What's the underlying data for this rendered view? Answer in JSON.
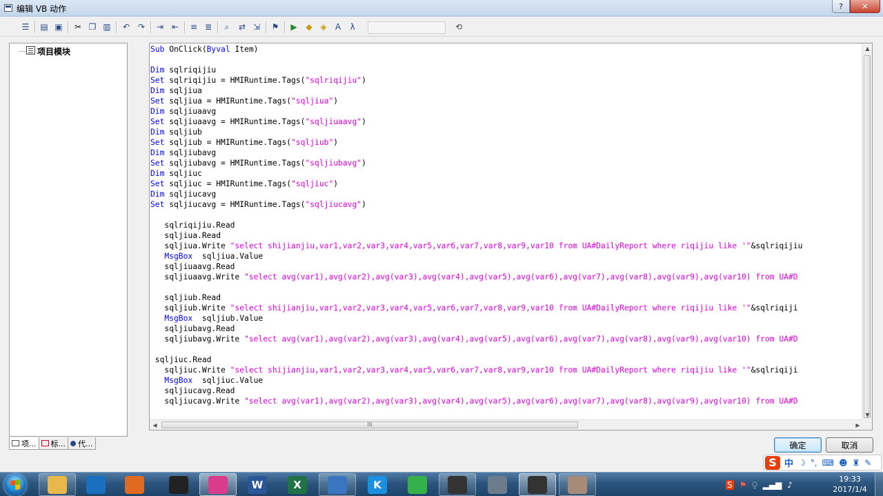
{
  "window": {
    "title": "编辑 VB 动作",
    "controls": {
      "help_label": "?",
      "close_label": "✕"
    }
  },
  "toolbar": {
    "icons": [
      "indent-icon",
      "outdent-icon",
      "print-icon",
      "print-preview-icon",
      "cut-icon",
      "copy-icon",
      "paste-icon",
      "undo-icon",
      "redo-icon",
      "increase-indent-icon",
      "decrease-indent-icon",
      "comment-icon",
      "uncomment-icon",
      "find-icon",
      "replace-icon",
      "goto-icon",
      "bookmark-icon",
      "compile-icon",
      "object-icon",
      "package-icon",
      "font-icon",
      "function-icon",
      "help-icon"
    ]
  },
  "tree": {
    "items": [
      {
        "label": "项目模块"
      }
    ]
  },
  "bottom_tabs": [
    {
      "label": "项..."
    },
    {
      "label": "标..."
    },
    {
      "label": "代..."
    }
  ],
  "code": {
    "lines": [
      [
        [
          "kw",
          "Sub"
        ],
        [
          "t",
          " OnClick("
        ],
        [
          "kw",
          "Byval"
        ],
        [
          "t",
          " Item)"
        ]
      ],
      [],
      [
        [
          "kw",
          "Dim"
        ],
        [
          "t",
          " sqlriqijiu"
        ]
      ],
      [
        [
          "kw",
          "Set"
        ],
        [
          "t",
          " sqlriqijiu = HMIRuntime.Tags("
        ],
        [
          "str",
          "\"sqlriqijiu\""
        ],
        [
          "t",
          ")"
        ]
      ],
      [
        [
          "kw",
          "Dim"
        ],
        [
          "t",
          " sqljiua"
        ]
      ],
      [
        [
          "kw",
          "Set"
        ],
        [
          "t",
          " sqljiua = HMIRuntime.Tags("
        ],
        [
          "str",
          "\"sqljiua\""
        ],
        [
          "t",
          ")"
        ]
      ],
      [
        [
          "kw",
          "Dim"
        ],
        [
          "t",
          " sqljiuaavg"
        ]
      ],
      [
        [
          "kw",
          "Set"
        ],
        [
          "t",
          " sqljiuaavg = HMIRuntime.Tags("
        ],
        [
          "str",
          "\"sqljiuaavg\""
        ],
        [
          "t",
          ")"
        ]
      ],
      [
        [
          "kw",
          "Dim"
        ],
        [
          "t",
          " sqljiub"
        ]
      ],
      [
        [
          "kw",
          "Set"
        ],
        [
          "t",
          " sqljiub = HMIRuntime.Tags("
        ],
        [
          "str",
          "\"sqljiub\""
        ],
        [
          "t",
          ")"
        ]
      ],
      [
        [
          "kw",
          "Dim"
        ],
        [
          "t",
          " sqljiubavg"
        ]
      ],
      [
        [
          "kw",
          "Set"
        ],
        [
          "t",
          " sqljiubavg = HMIRuntime.Tags("
        ],
        [
          "str",
          "\"sqljiubavg\""
        ],
        [
          "t",
          ")"
        ]
      ],
      [
        [
          "kw",
          "Dim"
        ],
        [
          "t",
          " sqljiuc"
        ]
      ],
      [
        [
          "kw",
          "Set"
        ],
        [
          "t",
          " sqljiuc = HMIRuntime.Tags("
        ],
        [
          "str",
          "\"sqljiuc\""
        ],
        [
          "t",
          ")"
        ]
      ],
      [
        [
          "kw",
          "Dim"
        ],
        [
          "t",
          " sqljiucavg"
        ]
      ],
      [
        [
          "kw",
          "Set"
        ],
        [
          "t",
          " sqljiucavg = HMIRuntime.Tags("
        ],
        [
          "str",
          "\"sqljiucavg\""
        ],
        [
          "t",
          ")"
        ]
      ],
      [],
      [
        [
          "t",
          "   sqlriqijiu.Read"
        ]
      ],
      [
        [
          "t",
          "   sqljiua.Read"
        ]
      ],
      [
        [
          "t",
          "   sqljiua.Write "
        ],
        [
          "str",
          "\"select shijianjiu,var1,var2,var3,var4,var5,var6,var7,var8,var9,var10 from UA#DailyReport where riqijiu like '\""
        ],
        [
          "t",
          "&sqlriqijiu"
        ]
      ],
      [
        [
          "kw",
          "   MsgBox"
        ],
        [
          "t",
          "  sqljiua.Value"
        ]
      ],
      [
        [
          "t",
          "   sqljiuaavg.Read"
        ]
      ],
      [
        [
          "t",
          "   sqljiuaavg.Write "
        ],
        [
          "str",
          "\"select avg(var1),avg(var2),avg(var3),avg(var4),avg(var5),avg(var6),avg(var7),avg(var8),avg(var9),avg(var10) from UA#D"
        ]
      ],
      [],
      [
        [
          "t",
          "   sqljiub.Read"
        ]
      ],
      [
        [
          "t",
          "   sqljiub.Write "
        ],
        [
          "str",
          "\"select shijianjiu,var1,var2,var3,var4,var5,var6,var7,var8,var9,var10 from UA#DailyReport where riqijiu like '\""
        ],
        [
          "t",
          "&sqlriqiji"
        ]
      ],
      [
        [
          "kw",
          "   MsgBox"
        ],
        [
          "t",
          "  sqljiub.Value"
        ]
      ],
      [
        [
          "t",
          "   sqljiubavg.Read"
        ]
      ],
      [
        [
          "t",
          "   sqljiubavg.Write "
        ],
        [
          "str",
          "\"select avg(var1),avg(var2),avg(var3),avg(var4),avg(var5),avg(var6),avg(var7),avg(var8),avg(var9),avg(var10) from UA#D"
        ]
      ],
      [],
      [
        [
          "t",
          " sqljiuc.Read"
        ]
      ],
      [
        [
          "t",
          "   sqljiuc.Write "
        ],
        [
          "str",
          "\"select shijianjiu,var1,var2,var3,var4,var5,var6,var7,var8,var9,var10 from UA#DailyReport where riqijiu like '\""
        ],
        [
          "t",
          "&sqlriqiji"
        ]
      ],
      [
        [
          "kw",
          "   MsgBox"
        ],
        [
          "t",
          "  sqljiuc.Value"
        ]
      ],
      [
        [
          "t",
          "   sqljiucavg.Read"
        ]
      ],
      [
        [
          "t",
          "   sqljiucavg.Write "
        ],
        [
          "str",
          "\"select avg(var1),avg(var2),avg(var3),avg(var4),avg(var5),avg(var6),avg(var7),avg(var8),avg(var9),avg(var10) from UA#D"
        ]
      ]
    ],
    "hscroll_grip": "III"
  },
  "buttons": {
    "ok_label": "确定",
    "cancel_label": "取消"
  },
  "ime": {
    "logo": "S",
    "mode": "中"
  },
  "taskbar": {
    "apps": [
      {
        "name": "explorer",
        "icon": "folder-icon",
        "color": "#e8b84a"
      },
      {
        "name": "network",
        "icon": "globe-icon",
        "color": "#1a6fc0"
      },
      {
        "name": "app-ring",
        "icon": "ring-icon",
        "color": "#e06a20"
      },
      {
        "name": "qq",
        "icon": "penguin-icon",
        "color": "#222222"
      },
      {
        "name": "picasa",
        "icon": "color-wheel-icon",
        "color": "#d83c8a"
      },
      {
        "name": "word",
        "icon": "word-icon",
        "label": "W",
        "color": "#2b579a"
      },
      {
        "name": "excel",
        "icon": "excel-icon",
        "label": "X",
        "color": "#217346"
      },
      {
        "name": "app-grid",
        "icon": "grid-icon",
        "color": "#3a76c0"
      },
      {
        "name": "kugou",
        "icon": "k-icon",
        "label": "K",
        "color": "#1b8fe0"
      },
      {
        "name": "app-refresh",
        "icon": "refresh-icon",
        "color": "#36b04a"
      },
      {
        "name": "wincc-1",
        "icon": "wincc-icon",
        "color": "#333333"
      },
      {
        "name": "app-plane",
        "icon": "plane-icon",
        "color": "#6c7c8c"
      },
      {
        "name": "wincc-2",
        "icon": "wincc-icon",
        "color": "#333333"
      },
      {
        "name": "photo",
        "icon": "photo-icon",
        "color": "#a88a78"
      }
    ],
    "clock_time": "19:33",
    "clock_date": "2017/1/4"
  }
}
